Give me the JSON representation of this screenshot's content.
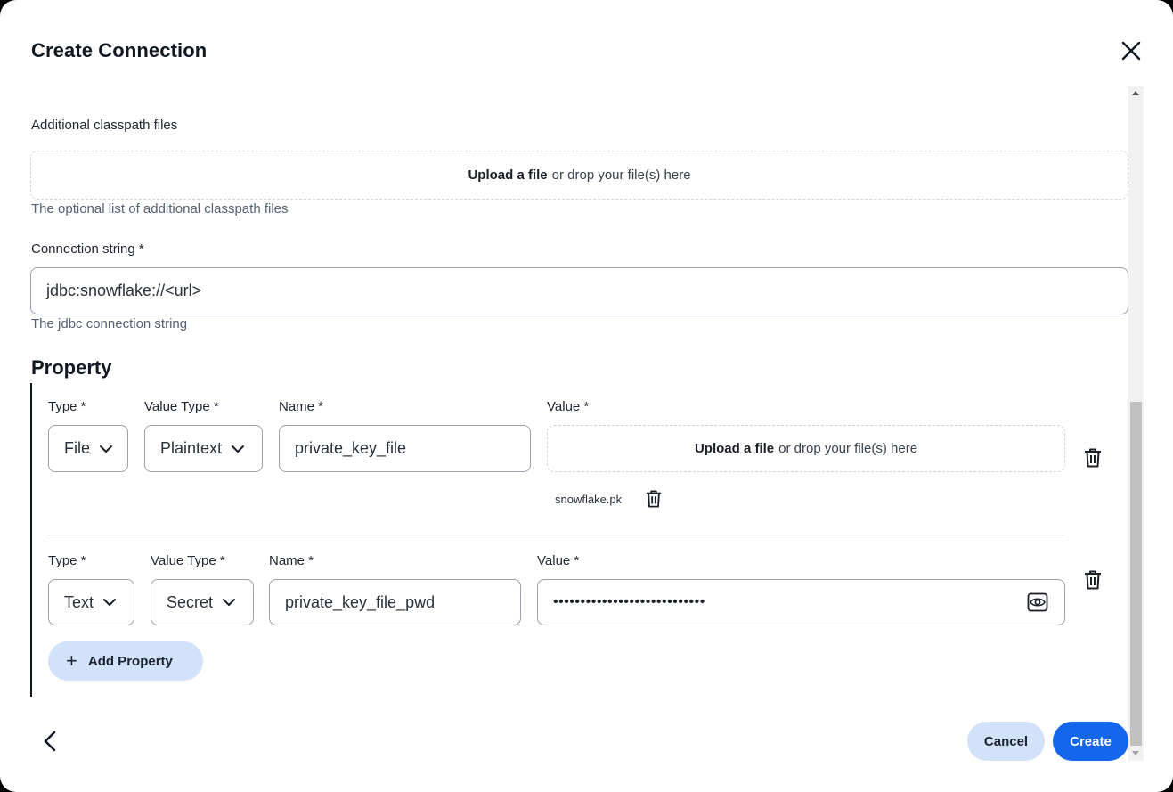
{
  "dialog": {
    "title": "Create Connection"
  },
  "classpath": {
    "label": "Additional classpath files",
    "upload_link": "Upload a file",
    "upload_rest": "or drop your file(s) here",
    "help": "The optional list of additional classpath files"
  },
  "connection": {
    "label": "Connection string *",
    "value": "jdbc:snowflake://<url>",
    "help": "The jdbc connection string"
  },
  "property": {
    "title": "Property",
    "rows": [
      {
        "type_label": "Type *",
        "type_value": "File",
        "value_type_label": "Value Type *",
        "value_type_value": "Plaintext",
        "name_label": "Name *",
        "name_value": "private_key_file",
        "value_label": "Value *",
        "upload_link": "Upload a file",
        "upload_rest": "or drop your file(s) here",
        "file_name": "snowflake.pk"
      },
      {
        "type_label": "Type *",
        "type_value": "Text",
        "value_type_label": "Value Type *",
        "value_type_value": "Secret",
        "name_label": "Name *",
        "name_value": "private_key_file_pwd",
        "value_label": "Value *",
        "value_masked": "••••••••••••••••••••••••••••"
      }
    ],
    "add_label": "Add Property"
  },
  "footer": {
    "cancel_label": "Cancel",
    "create_label": "Create"
  },
  "colors": {
    "primary": "#1466ec",
    "secondary_bg": "#d3e2fb"
  },
  "icons": [
    "close-icon",
    "chevron-down-icon",
    "trash-icon",
    "eye-icon",
    "plus-icon",
    "chevron-left-icon"
  ]
}
